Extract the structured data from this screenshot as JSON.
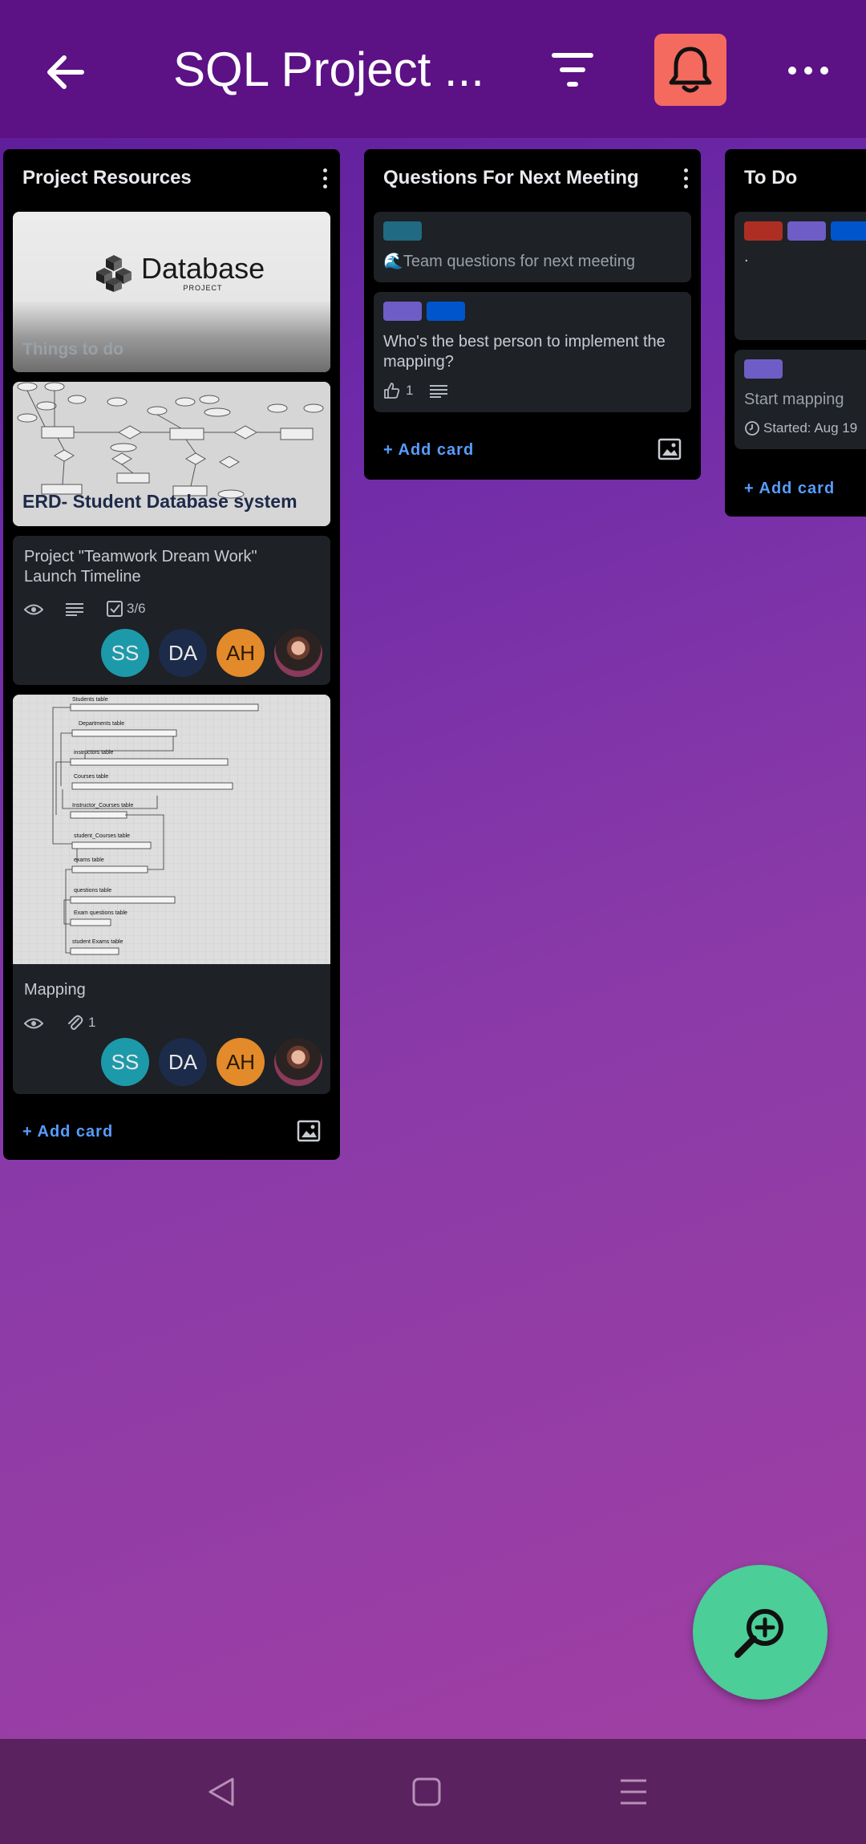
{
  "header": {
    "title": "SQL Project ....",
    "back_icon": "arrow-left-icon",
    "filter_icon": "filter-icon",
    "bell_icon": "bell-icon",
    "more_icon": "more-horizontal-icon",
    "bell_bg": "#f46a5e",
    "bg": "#5c1185"
  },
  "lists": [
    {
      "title": "Project Resources",
      "cards": [
        {
          "cover_text_big": "Database",
          "cover_text_small": "PROJECT",
          "title": "Things to do"
        },
        {
          "title": "ERD- Student Database system"
        },
        {
          "title": "Project \"Teamwork Dream Work\" Launch Timeline",
          "checklist": "3/6",
          "members": [
            "SS",
            "DA",
            "AH"
          ]
        },
        {
          "title": "Mapping",
          "attachments": "1",
          "members": [
            "SS",
            "DA",
            "AH"
          ],
          "diagram_labels": [
            "Students table",
            "Departments table",
            "instructors table",
            "Courses table",
            "Instructor_Courses table",
            "student_Courses table",
            "exams table",
            "questions table",
            "Exam questions table",
            "student Exams table"
          ]
        }
      ],
      "add_card": "+ Add card"
    },
    {
      "title": "Questions For Next Meeting",
      "cards": [
        {
          "title": "🌊Team questions for next meeting"
        },
        {
          "title": "Who's the best person to implement the mapping?",
          "likes": "1"
        }
      ],
      "add_card": "+ Add card"
    },
    {
      "title": "To Do",
      "cards": [
        {
          "title": "."
        },
        {
          "title": "Start mapping",
          "date": "Started: Aug 19"
        }
      ],
      "add_card": "+ Add card"
    }
  ],
  "colors": {
    "label_teal": "#206a83",
    "label_purple": "#6e5dc6",
    "label_blue": "#0055cc",
    "label_red": "#ae2e24",
    "avatar_ss": "#1d9aaa",
    "avatar_da": "#1c2b4a",
    "avatar_ah": "#e38a2b",
    "fab": "#4bce97",
    "link": "#579dff"
  },
  "fab": {
    "icon": "zoom-in-icon"
  },
  "navbar": {
    "back_icon": "nav-back-icon",
    "home_icon": "nav-home-icon",
    "menu_icon": "nav-menu-icon"
  }
}
